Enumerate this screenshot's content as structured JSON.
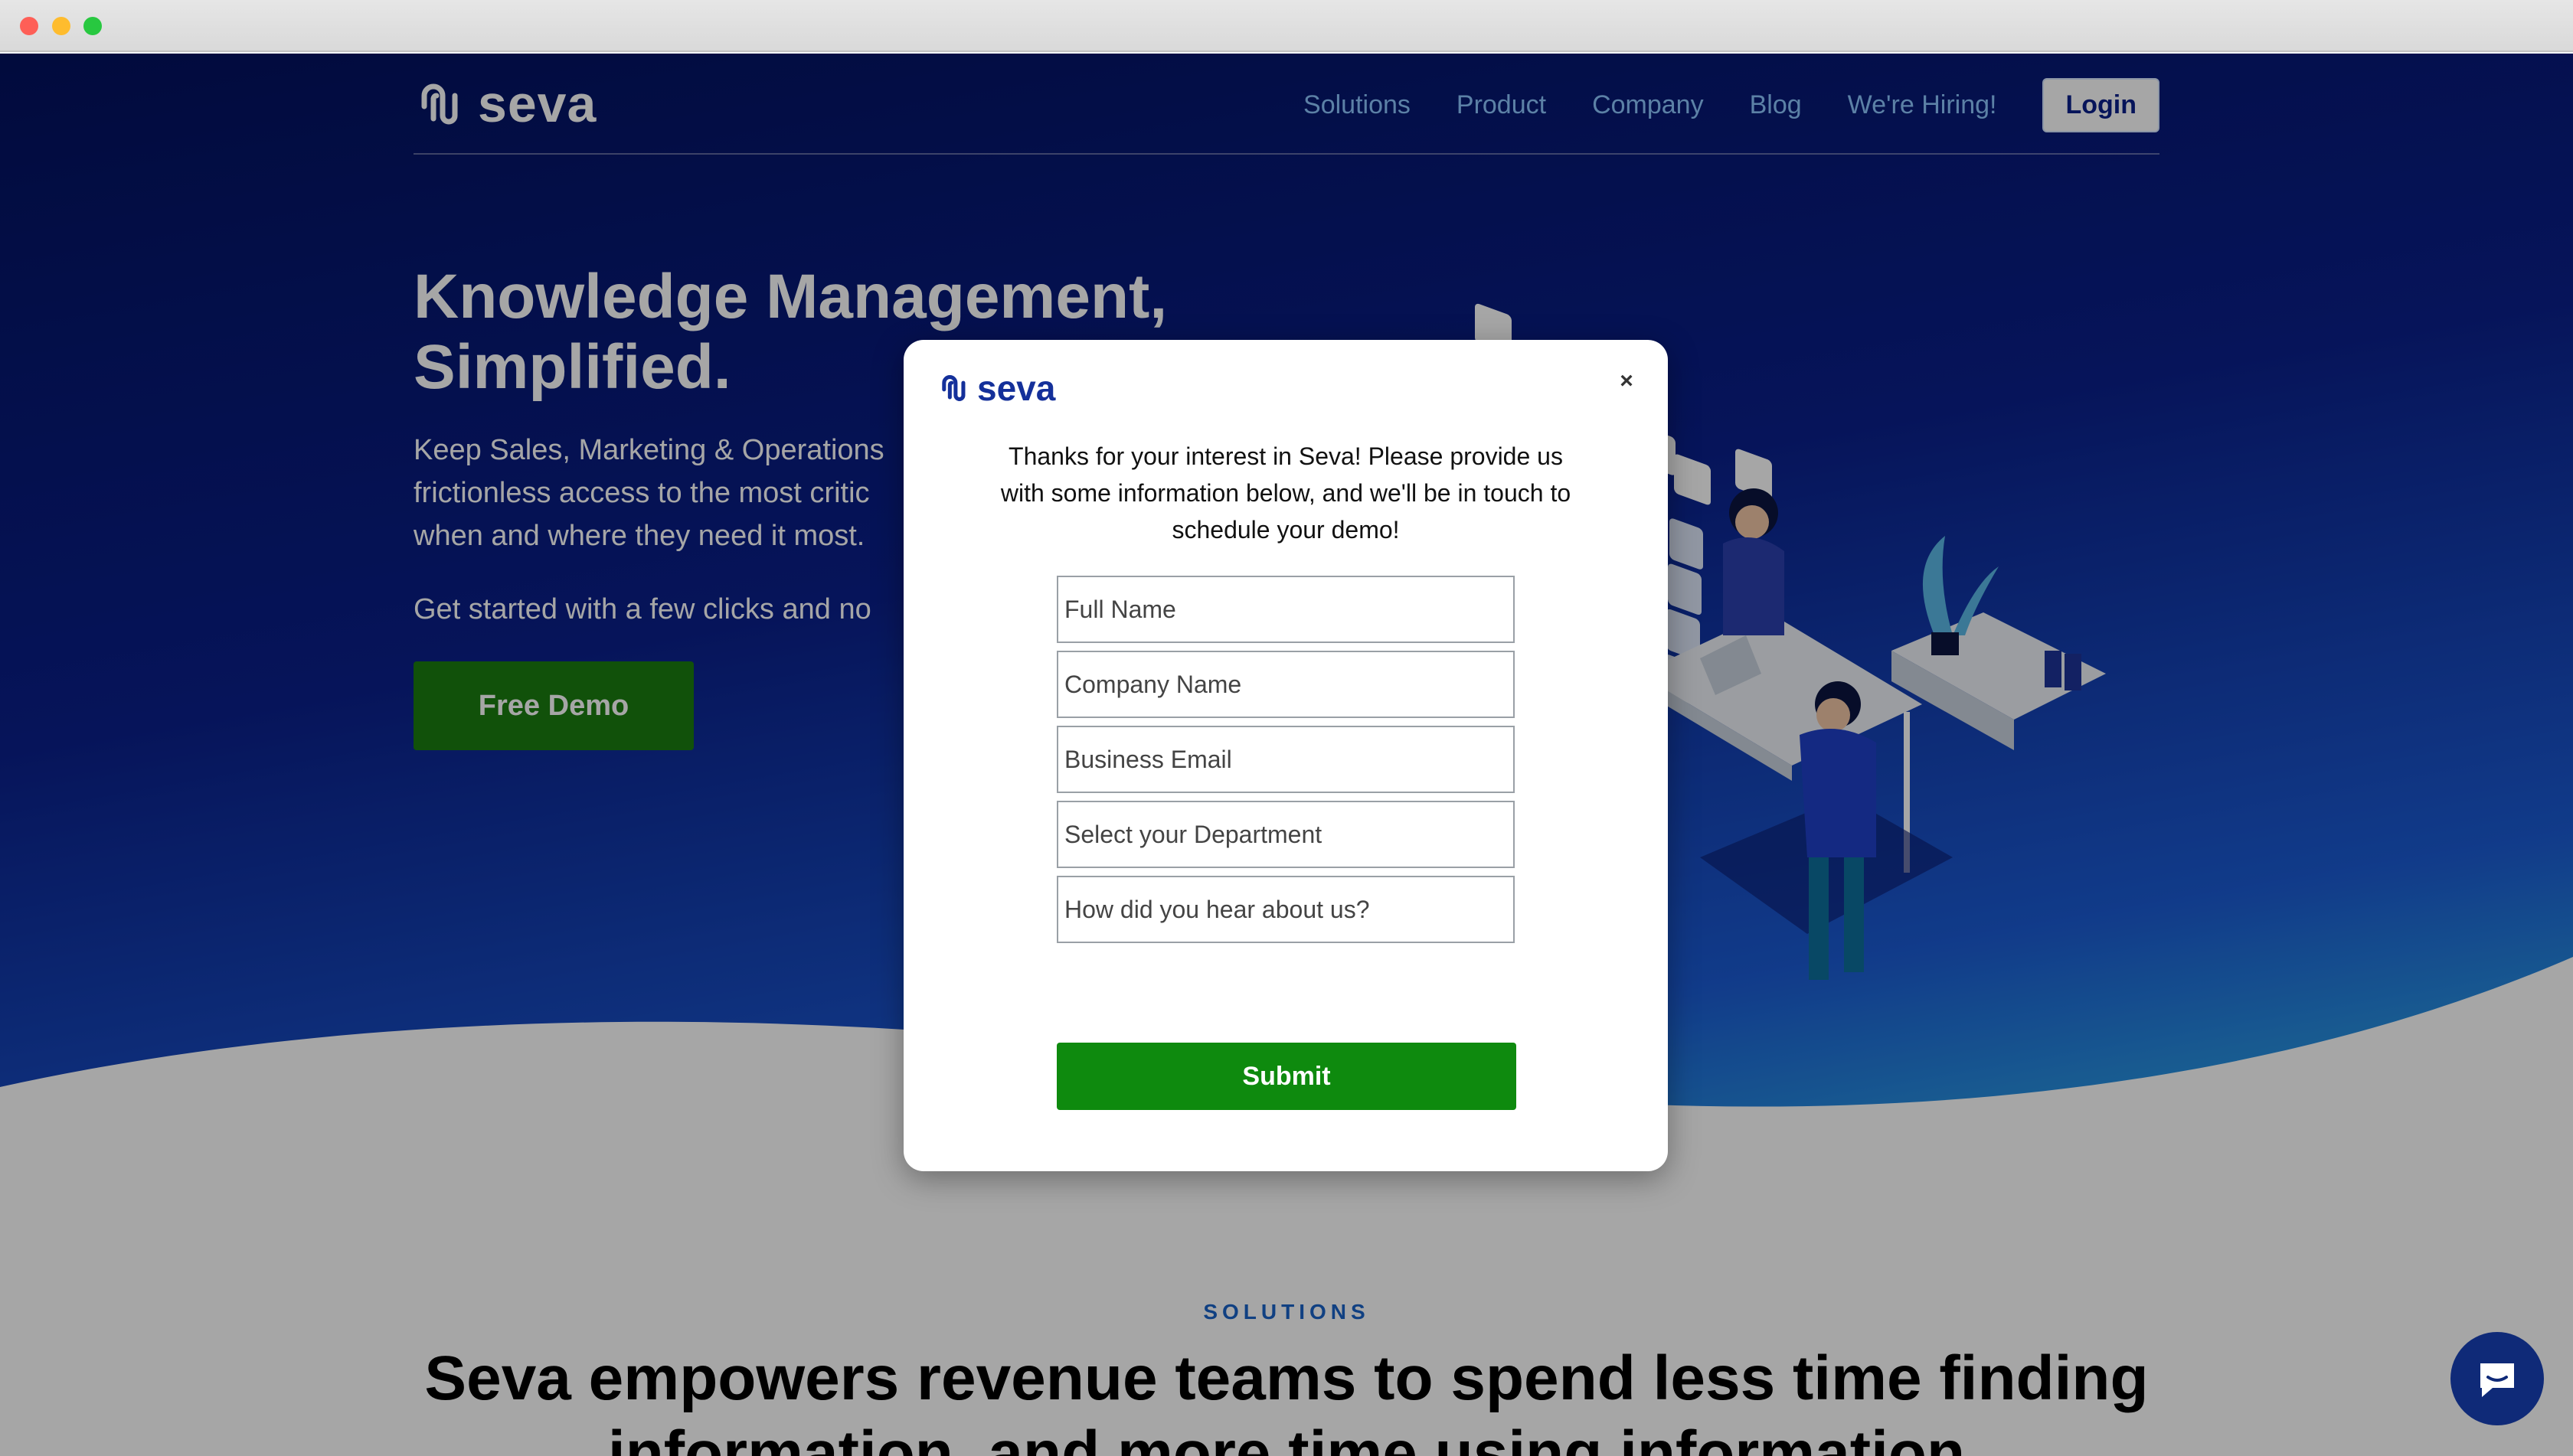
{
  "nav": {
    "brand": "seva",
    "links": [
      "Solutions",
      "Product",
      "Company",
      "Blog",
      "We're Hiring!"
    ],
    "login_label": "Login"
  },
  "hero": {
    "title_line1": "Knowledge Management,",
    "title_line2": "Simplified.",
    "subtitle_line1": "Keep Sales, Marketing & Operations",
    "subtitle_line2": "frictionless access to the most critic",
    "subtitle_line3": "when and where they need it most.",
    "subtitle2": "Get started with a few clicks and no",
    "cta_label": "Free Demo"
  },
  "solutions": {
    "eyebrow": "SOLUTIONS",
    "title_line1": "Seva empowers revenue teams to spend less time finding",
    "title_line2": "information, and more time using information"
  },
  "modal": {
    "brand": "seva",
    "close_icon": "×",
    "message": "Thanks for your interest in Seva! Please provide us with some information below, and we'll be in touch to schedule your demo!",
    "fields": {
      "full_name": "Full Name",
      "company_name": "Company Name",
      "business_email": "Business Email",
      "department": "Select your Department",
      "referral": "How did you hear about us?"
    },
    "submit_label": "Submit"
  },
  "chat": {
    "icon": "chat-bubble-icon"
  },
  "colors": {
    "hero_dark": "#03115e",
    "hero_light": "#2fb8e8",
    "cta_green": "#1b7d10",
    "submit_green": "#0e8a0e",
    "brand_blue": "#14309a",
    "eyebrow_blue": "#1a63c8"
  }
}
